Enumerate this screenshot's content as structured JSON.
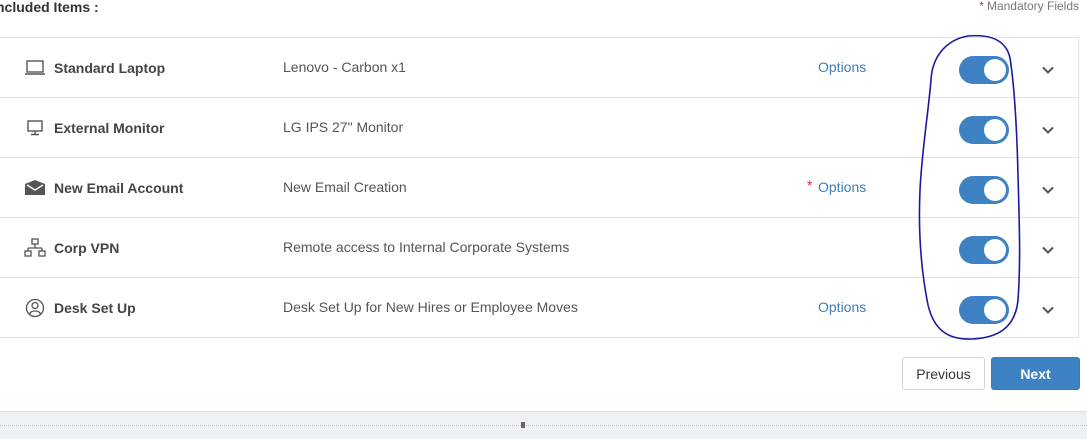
{
  "header": {
    "title": "ncluded Items :",
    "mandatory_star": "*",
    "mandatory_label": "Mandatory Fields"
  },
  "items": [
    {
      "icon": "laptop-icon",
      "name": "Standard Laptop",
      "description": "Lenovo - Carbon x1",
      "options": "Options",
      "options_required": false,
      "enabled": true
    },
    {
      "icon": "monitor-icon",
      "name": "External Monitor",
      "description": "LG IPS 27\" Monitor",
      "options": "",
      "options_required": false,
      "enabled": true
    },
    {
      "icon": "envelope-icon",
      "name": "New Email Account",
      "description": "New Email Creation",
      "options": "Options",
      "options_required": true,
      "enabled": true
    },
    {
      "icon": "network-icon",
      "name": "Corp VPN",
      "description": "Remote access to Internal Corporate Systems",
      "options": "",
      "options_required": false,
      "enabled": true
    },
    {
      "icon": "user-circle-icon",
      "name": "Desk Set Up",
      "description": "Desk Set Up for New Hires or Employee Moves",
      "options": "Options",
      "options_required": false,
      "enabled": true
    }
  ],
  "buttons": {
    "previous": "Previous",
    "next": "Next"
  },
  "colors": {
    "accent": "#3e82c4",
    "link": "#3f7fb5",
    "required": "#c0392b",
    "annotation": "#1a1aa0"
  }
}
